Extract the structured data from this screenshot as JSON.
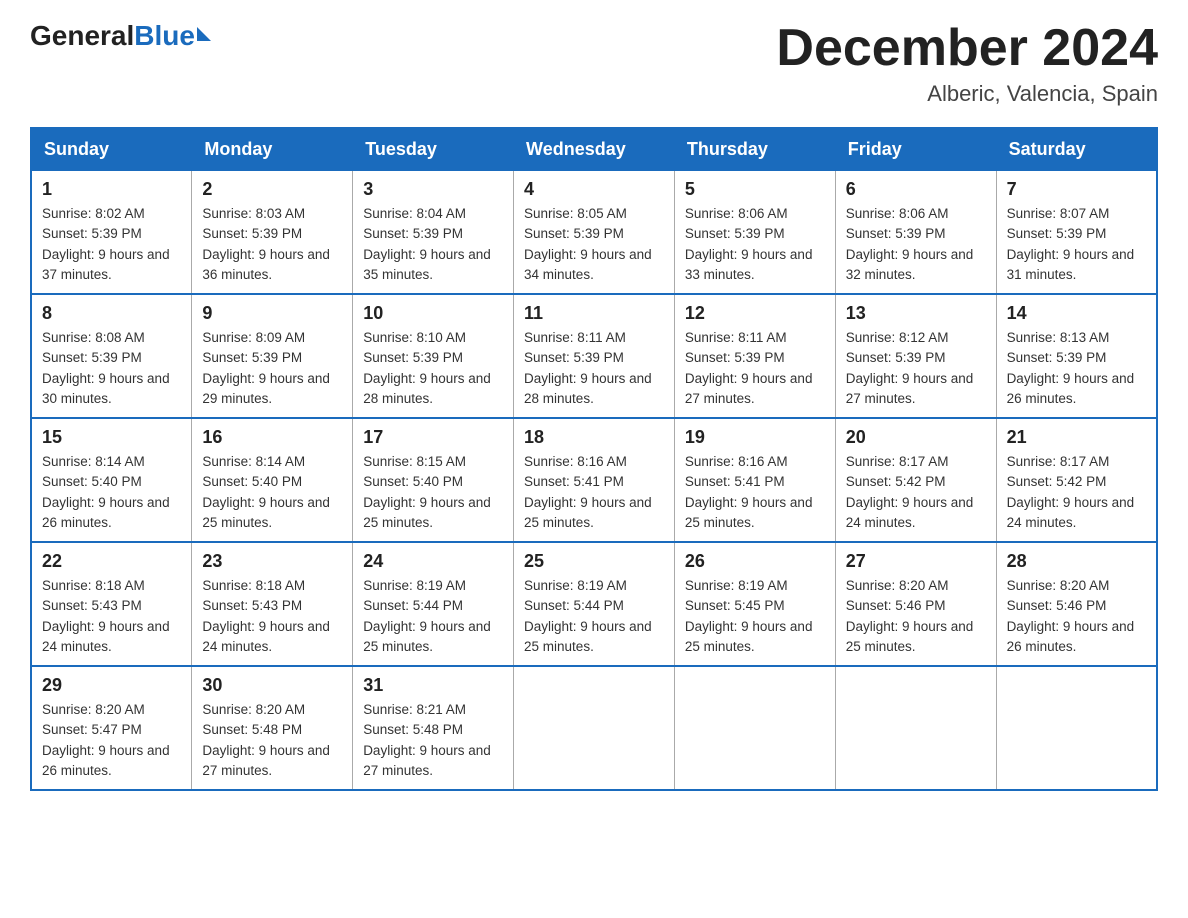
{
  "header": {
    "logo": {
      "general": "General",
      "blue": "Blue"
    },
    "title": "December 2024",
    "location": "Alberic, Valencia, Spain"
  },
  "days_of_week": [
    "Sunday",
    "Monday",
    "Tuesday",
    "Wednesday",
    "Thursday",
    "Friday",
    "Saturday"
  ],
  "weeks": [
    [
      {
        "day": "1",
        "sunrise": "8:02 AM",
        "sunset": "5:39 PM",
        "daylight": "9 hours and 37 minutes."
      },
      {
        "day": "2",
        "sunrise": "8:03 AM",
        "sunset": "5:39 PM",
        "daylight": "9 hours and 36 minutes."
      },
      {
        "day": "3",
        "sunrise": "8:04 AM",
        "sunset": "5:39 PM",
        "daylight": "9 hours and 35 minutes."
      },
      {
        "day": "4",
        "sunrise": "8:05 AM",
        "sunset": "5:39 PM",
        "daylight": "9 hours and 34 minutes."
      },
      {
        "day": "5",
        "sunrise": "8:06 AM",
        "sunset": "5:39 PM",
        "daylight": "9 hours and 33 minutes."
      },
      {
        "day": "6",
        "sunrise": "8:06 AM",
        "sunset": "5:39 PM",
        "daylight": "9 hours and 32 minutes."
      },
      {
        "day": "7",
        "sunrise": "8:07 AM",
        "sunset": "5:39 PM",
        "daylight": "9 hours and 31 minutes."
      }
    ],
    [
      {
        "day": "8",
        "sunrise": "8:08 AM",
        "sunset": "5:39 PM",
        "daylight": "9 hours and 30 minutes."
      },
      {
        "day": "9",
        "sunrise": "8:09 AM",
        "sunset": "5:39 PM",
        "daylight": "9 hours and 29 minutes."
      },
      {
        "day": "10",
        "sunrise": "8:10 AM",
        "sunset": "5:39 PM",
        "daylight": "9 hours and 28 minutes."
      },
      {
        "day": "11",
        "sunrise": "8:11 AM",
        "sunset": "5:39 PM",
        "daylight": "9 hours and 28 minutes."
      },
      {
        "day": "12",
        "sunrise": "8:11 AM",
        "sunset": "5:39 PM",
        "daylight": "9 hours and 27 minutes."
      },
      {
        "day": "13",
        "sunrise": "8:12 AM",
        "sunset": "5:39 PM",
        "daylight": "9 hours and 27 minutes."
      },
      {
        "day": "14",
        "sunrise": "8:13 AM",
        "sunset": "5:39 PM",
        "daylight": "9 hours and 26 minutes."
      }
    ],
    [
      {
        "day": "15",
        "sunrise": "8:14 AM",
        "sunset": "5:40 PM",
        "daylight": "9 hours and 26 minutes."
      },
      {
        "day": "16",
        "sunrise": "8:14 AM",
        "sunset": "5:40 PM",
        "daylight": "9 hours and 25 minutes."
      },
      {
        "day": "17",
        "sunrise": "8:15 AM",
        "sunset": "5:40 PM",
        "daylight": "9 hours and 25 minutes."
      },
      {
        "day": "18",
        "sunrise": "8:16 AM",
        "sunset": "5:41 PM",
        "daylight": "9 hours and 25 minutes."
      },
      {
        "day": "19",
        "sunrise": "8:16 AM",
        "sunset": "5:41 PM",
        "daylight": "9 hours and 25 minutes."
      },
      {
        "day": "20",
        "sunrise": "8:17 AM",
        "sunset": "5:42 PM",
        "daylight": "9 hours and 24 minutes."
      },
      {
        "day": "21",
        "sunrise": "8:17 AM",
        "sunset": "5:42 PM",
        "daylight": "9 hours and 24 minutes."
      }
    ],
    [
      {
        "day": "22",
        "sunrise": "8:18 AM",
        "sunset": "5:43 PM",
        "daylight": "9 hours and 24 minutes."
      },
      {
        "day": "23",
        "sunrise": "8:18 AM",
        "sunset": "5:43 PM",
        "daylight": "9 hours and 24 minutes."
      },
      {
        "day": "24",
        "sunrise": "8:19 AM",
        "sunset": "5:44 PM",
        "daylight": "9 hours and 25 minutes."
      },
      {
        "day": "25",
        "sunrise": "8:19 AM",
        "sunset": "5:44 PM",
        "daylight": "9 hours and 25 minutes."
      },
      {
        "day": "26",
        "sunrise": "8:19 AM",
        "sunset": "5:45 PM",
        "daylight": "9 hours and 25 minutes."
      },
      {
        "day": "27",
        "sunrise": "8:20 AM",
        "sunset": "5:46 PM",
        "daylight": "9 hours and 25 minutes."
      },
      {
        "day": "28",
        "sunrise": "8:20 AM",
        "sunset": "5:46 PM",
        "daylight": "9 hours and 26 minutes."
      }
    ],
    [
      {
        "day": "29",
        "sunrise": "8:20 AM",
        "sunset": "5:47 PM",
        "daylight": "9 hours and 26 minutes."
      },
      {
        "day": "30",
        "sunrise": "8:20 AM",
        "sunset": "5:48 PM",
        "daylight": "9 hours and 27 minutes."
      },
      {
        "day": "31",
        "sunrise": "8:21 AM",
        "sunset": "5:48 PM",
        "daylight": "9 hours and 27 minutes."
      },
      null,
      null,
      null,
      null
    ]
  ]
}
